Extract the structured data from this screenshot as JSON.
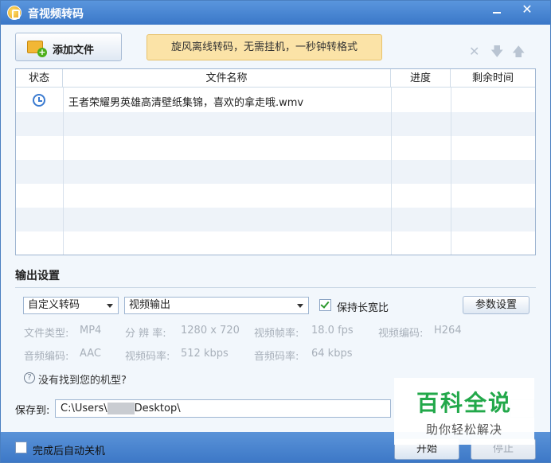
{
  "window": {
    "title": "音视频转码"
  },
  "toolbar": {
    "add_file_label": "添加文件",
    "promo_text": "旋风离线转码，无需挂机，一秒钟转格式"
  },
  "table": {
    "columns": [
      "状态",
      "文件名称",
      "进度",
      "剩余时间"
    ],
    "rows": [
      {
        "status_icon": "clock-icon",
        "name": "王者荣耀男英雄高清壁纸集锦，喜欢的拿走哦.wmv",
        "progress": "",
        "remaining": ""
      }
    ]
  },
  "output": {
    "section_title": "输出设置",
    "preset_selected": "自定义转码",
    "output_selected": "视频输出",
    "keep_ratio_label": "保持长宽比",
    "keep_ratio_checked": true,
    "params_button": "参数设置",
    "specs": [
      {
        "label": "文件类型:",
        "value": "MP4"
      },
      {
        "label": "分 辨 率:",
        "value": "1280 x 720"
      },
      {
        "label": "视频帧率:",
        "value": "18.0 fps"
      },
      {
        "label": "视频编码:",
        "value": "H264"
      },
      {
        "label": "音频编码:",
        "value": "AAC"
      },
      {
        "label": "视频码率:",
        "value": "512 kbps"
      },
      {
        "label": "音频码率:",
        "value": "64 kbps"
      }
    ],
    "help_text": "没有找到您的机型?"
  },
  "save": {
    "label": "保存到:",
    "path_prefix": "C:\\Users\\",
    "path_suffix": "Desktop\\"
  },
  "bottom": {
    "auto_shutdown_label": "完成后自动关机",
    "start_button": "开始",
    "stop_button": "停止"
  },
  "watermark": {
    "main": "百科全说",
    "sub": "助你轻松解决"
  },
  "colors": {
    "titlebar": "#3a77c8",
    "promo_bg": "#fbe3a7",
    "watermark_green": "#22a84a"
  }
}
